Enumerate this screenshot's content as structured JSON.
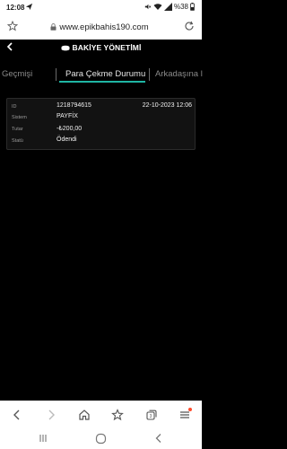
{
  "status_bar": {
    "time": "12:08",
    "battery": "%38"
  },
  "browser": {
    "url": "www.epikbahis190.com"
  },
  "header": {
    "title": "BAKİYE YÖNETİMİ"
  },
  "tabs": [
    {
      "label": "lem Geçmişi",
      "active": false
    },
    {
      "label": "Para Çekme Durumu",
      "active": true
    },
    {
      "label": "Arkadaşına l",
      "active": false
    }
  ],
  "transaction": {
    "rows": [
      {
        "label": "ID",
        "value": "1218794615",
        "extra": "22-10-2023 12:06"
      },
      {
        "label": "Sistem",
        "value": "PAYFİX"
      },
      {
        "label": "Tutar",
        "value": "-₺200,00"
      },
      {
        "label": "Statü",
        "value": "Ödendi"
      }
    ]
  },
  "colors": {
    "accent": "#1fb5a3",
    "background": "#000000",
    "card": "#121212",
    "badge": "#ff4b2b"
  },
  "icons": {
    "status": [
      "send-icon",
      "mute-icon",
      "wifi-icon",
      "signal-icon",
      "battery-icon"
    ],
    "browser": [
      "home-icon",
      "lock-icon",
      "refresh-icon"
    ],
    "bottom_nav": [
      "back-arrow-icon",
      "forward-arrow-icon",
      "home-icon",
      "bookmark-star-icon",
      "tabs-icon",
      "menu-icon"
    ],
    "system_nav": [
      "recent-apps-icon",
      "home-circle-icon",
      "back-chevron-icon"
    ]
  }
}
